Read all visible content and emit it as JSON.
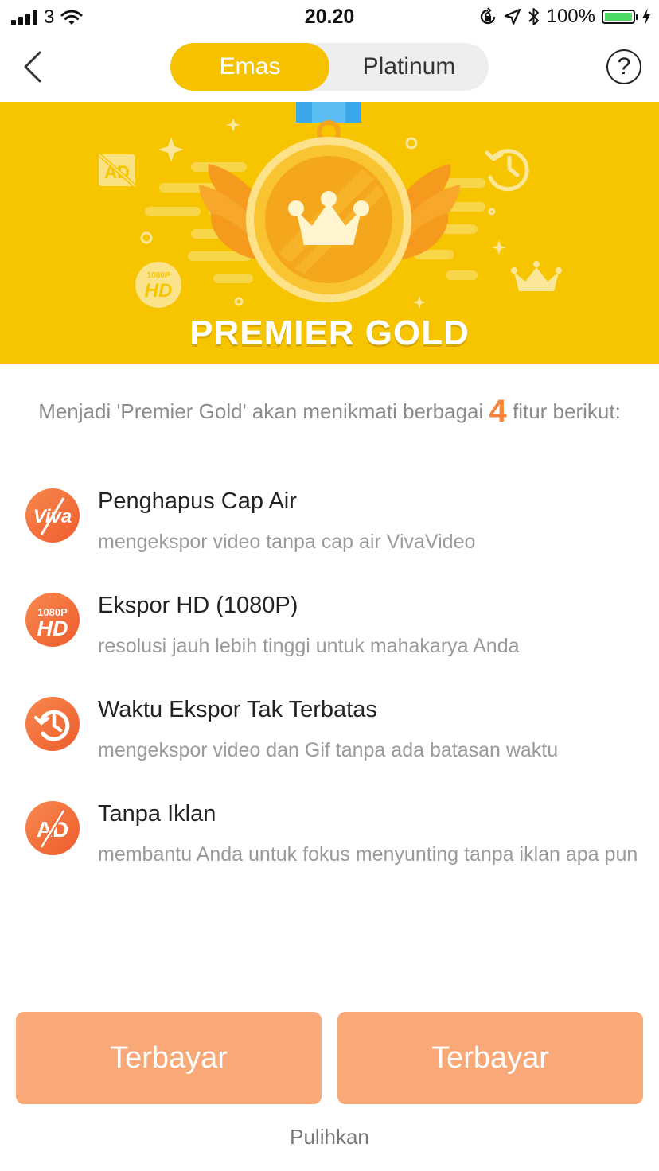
{
  "status_bar": {
    "carrier": "3",
    "time": "20.20",
    "battery_percent": "100%",
    "battery_level": 1.0,
    "colors": {
      "battery": "#4cd964"
    }
  },
  "nav": {
    "back_icon": "chevron-left-icon",
    "tabs": [
      {
        "label": "Emas",
        "active": true
      },
      {
        "label": "Platinum",
        "active": false
      }
    ],
    "help_symbol": "?"
  },
  "banner": {
    "title": "PREMIER GOLD",
    "colors": {
      "background": "#f6c500",
      "medal": "#f9b918"
    }
  },
  "intro": {
    "text_before": "Menjadi 'Premier Gold' akan menikmati berbagai",
    "count": "4",
    "text_after": "fitur berikut:"
  },
  "features": [
    {
      "icon": "viva-watermark-remove-icon",
      "icon_text": "Viva",
      "title": "Penghapus Cap Air",
      "desc": "mengekspor video tanpa cap air VivaVideo"
    },
    {
      "icon": "hd-1080p-icon",
      "icon_text_small": "1080P",
      "icon_text": "HD",
      "title": "Ekspor HD (1080P)",
      "desc": "resolusi jauh lebih tinggi untuk mahakarya Anda"
    },
    {
      "icon": "history-clock-icon",
      "title": "Waktu Ekspor Tak Terbatas",
      "desc": "mengekspor video dan Gif tanpa ada batasan waktu"
    },
    {
      "icon": "no-ads-icon",
      "icon_text": "AD",
      "title": "Tanpa Iklan",
      "desc": "membantu Anda untuk fokus menyunting tanpa iklan apa pun"
    }
  ],
  "buttons": {
    "pay_left": "Terbayar",
    "pay_right": "Terbayar",
    "restore": "Pulihkan",
    "colors": {
      "pay": "#f9a877",
      "accent": "#f5833a"
    }
  }
}
